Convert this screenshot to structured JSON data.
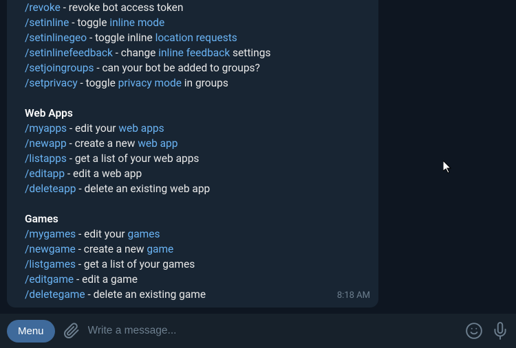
{
  "message": {
    "cmds_top": [
      {
        "cmd": "/revoke",
        "mid": " - revoke bot access token",
        "tail_link": ""
      },
      {
        "cmd": "/setinline",
        "mid": " - toggle ",
        "tail_link": "inline mode"
      },
      {
        "cmd": "/setinlinegeo",
        "mid": " - toggle inline ",
        "tail_link": "location requests"
      },
      {
        "cmd": "/setinlinefeedback",
        "mid": " - change ",
        "tail_link": "inline feedback",
        "after": " settings"
      },
      {
        "cmd": "/setjoingroups",
        "mid": " - can your bot be added to groups?",
        "tail_link": ""
      },
      {
        "cmd": "/setprivacy",
        "mid": " - toggle ",
        "tail_link": "privacy mode",
        "after": " in groups"
      }
    ],
    "section_webapps": "Web Apps",
    "cmds_webapps": [
      {
        "cmd": "/myapps",
        "mid": " - edit your ",
        "tail_link": "web apps"
      },
      {
        "cmd": "/newapp",
        "mid": " - create a new ",
        "tail_link": "web app"
      },
      {
        "cmd": "/listapps",
        "mid": " - get a list of your web apps",
        "tail_link": ""
      },
      {
        "cmd": "/editapp",
        "mid": " - edit a web app",
        "tail_link": ""
      },
      {
        "cmd": "/deleteapp",
        "mid": " - delete an existing web app",
        "tail_link": ""
      }
    ],
    "section_games": "Games",
    "cmds_games": [
      {
        "cmd": "/mygames",
        "mid": " - edit your ",
        "tail_link": "games"
      },
      {
        "cmd": "/newgame",
        "mid": " - create a new ",
        "tail_link": "game"
      },
      {
        "cmd": "/listgames",
        "mid": " - get a list of your games",
        "tail_link": ""
      },
      {
        "cmd": "/editgame",
        "mid": " - edit a game",
        "tail_link": ""
      },
      {
        "cmd": "/deletegame",
        "mid": " - delete an existing game",
        "tail_link": ""
      }
    ],
    "timestamp": "8:18 AM"
  },
  "input_bar": {
    "menu_label": "Menu",
    "placeholder": "Write a message..."
  }
}
